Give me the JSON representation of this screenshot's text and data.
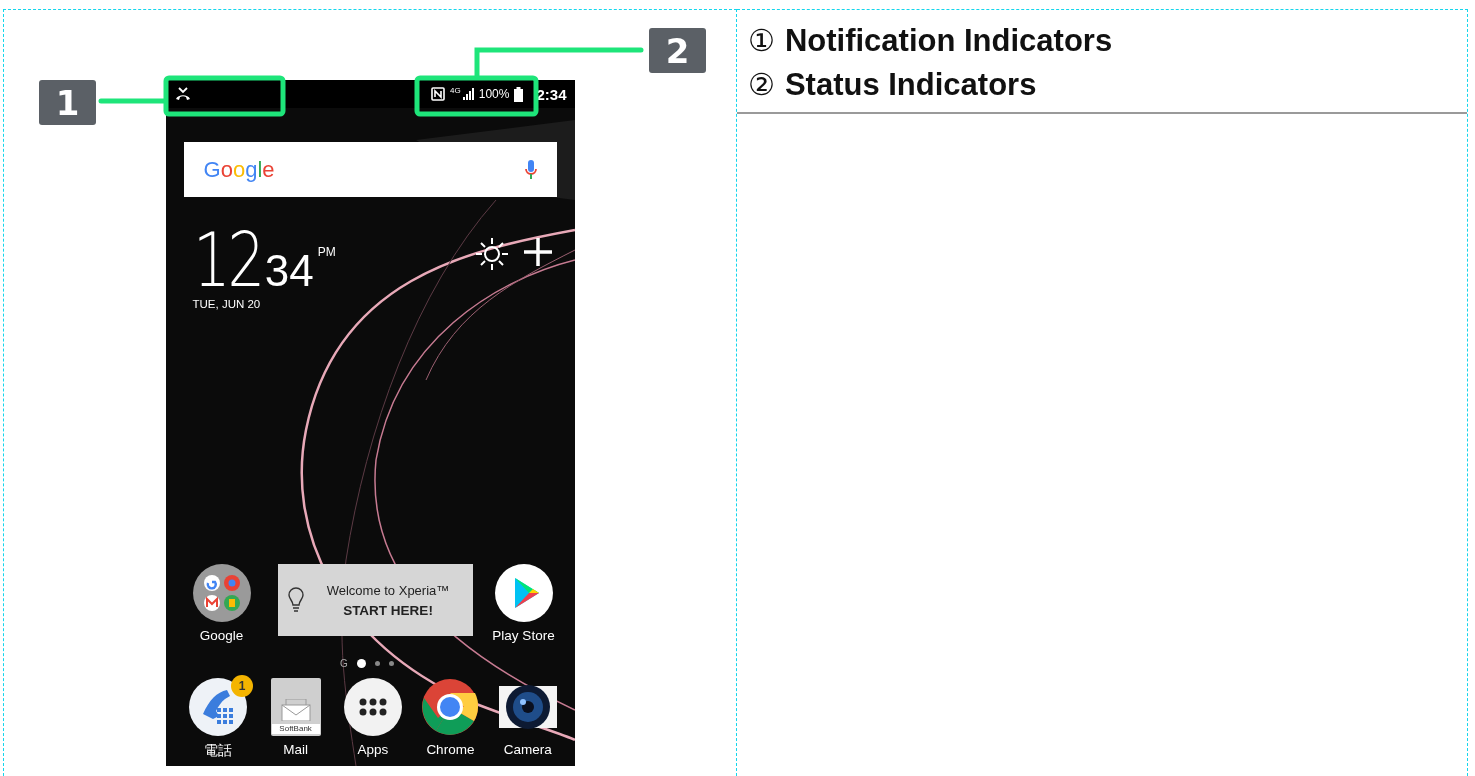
{
  "callouts": [
    {
      "number": "1"
    },
    {
      "number": "2"
    }
  ],
  "phone": {
    "status_bar": {
      "network": "4G",
      "battery": "100%",
      "time": "2:34"
    },
    "search_widget": {
      "logo": "Google"
    },
    "clock": {
      "hour": "12",
      "minute": "34",
      "ampm": "PM",
      "date": "TUE, JUN 20"
    },
    "welcome_card": {
      "title": "Welcome to Xperia™",
      "action": "START HERE!"
    },
    "home_apps": [
      {
        "label": "Google",
        "kind": "folder"
      },
      {
        "label": "Play Store",
        "kind": "play"
      }
    ],
    "page_indicator": {
      "google_label": "G",
      "pages": [
        {
          "selected": true
        },
        {
          "selected": false
        },
        {
          "selected": false
        }
      ]
    },
    "dock": [
      {
        "label": "電話",
        "kind": "phone",
        "badge": "1"
      },
      {
        "label": "Mail",
        "kind": "mail",
        "brand": "SoftBank"
      },
      {
        "label": "Apps",
        "kind": "apps"
      },
      {
        "label": "Chrome",
        "kind": "chrome"
      },
      {
        "label": "Camera",
        "kind": "camera"
      }
    ]
  },
  "legend": [
    {
      "marker": "①",
      "label": "Notification Indicators"
    },
    {
      "marker": "②",
      "label": "Status Indicators"
    }
  ]
}
